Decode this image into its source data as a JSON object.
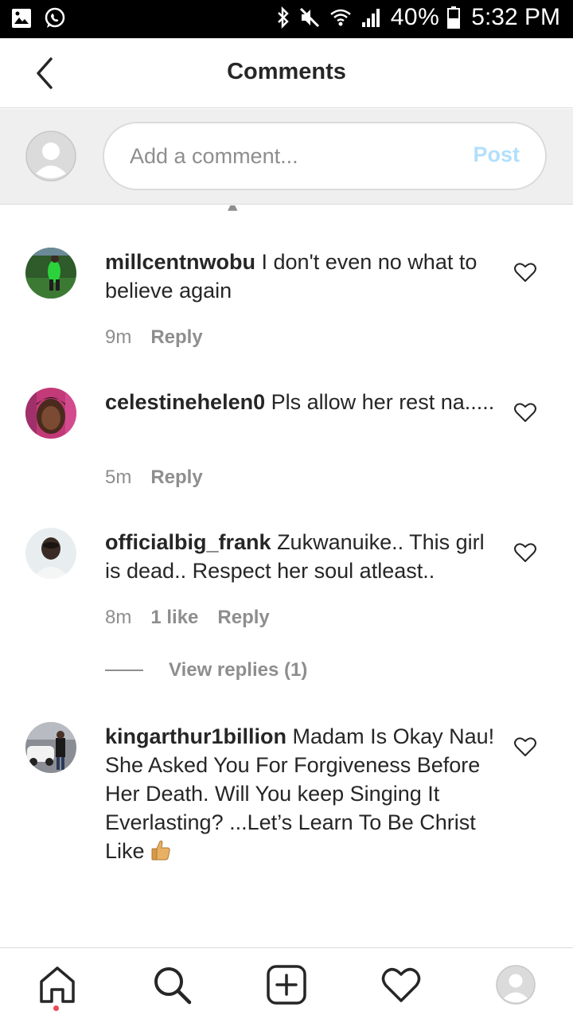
{
  "status_bar": {
    "battery": "40%",
    "time": "5:32 PM",
    "icons": [
      "gallery-icon",
      "whatsapp-icon",
      "bluetooth-icon",
      "mute-icon",
      "wifi-icon",
      "signal-icon",
      "battery-icon"
    ]
  },
  "header": {
    "title": "Comments",
    "back_icon": "chevron-left-icon"
  },
  "composer": {
    "placeholder": "Add a comment...",
    "post_label": "Post",
    "post_color": "#b2dffc"
  },
  "comments": [
    {
      "username": "millcentnwobu",
      "text": "I don't even no what to believe again",
      "time": "9m",
      "likes": "",
      "reply_label": "Reply"
    },
    {
      "username": "celestinehelen0",
      "text": "Pls allow her rest na.....",
      "time": "5m",
      "likes": "",
      "reply_label": "Reply"
    },
    {
      "username": "officialbig_frank",
      "text": "Zukwanuike.. This girl is dead.. Respect her soul atleast..",
      "time": "8m",
      "likes": "1 like",
      "reply_label": "Reply",
      "view_replies": "View replies (1)"
    },
    {
      "username": "kingarthur1billion",
      "text": "Madam Is Okay Nau! She Asked You For Forgiveness Before Her Death. Will You keep Singing It Everlasting? ...Let’s Learn To Be Christ Like",
      "emoji": "thumbs-up"
    }
  ],
  "bottom_nav": {
    "items": [
      "home-icon",
      "search-icon",
      "add-post-icon",
      "heart-icon",
      "profile-icon"
    ],
    "notification_color": "#ed4956"
  }
}
